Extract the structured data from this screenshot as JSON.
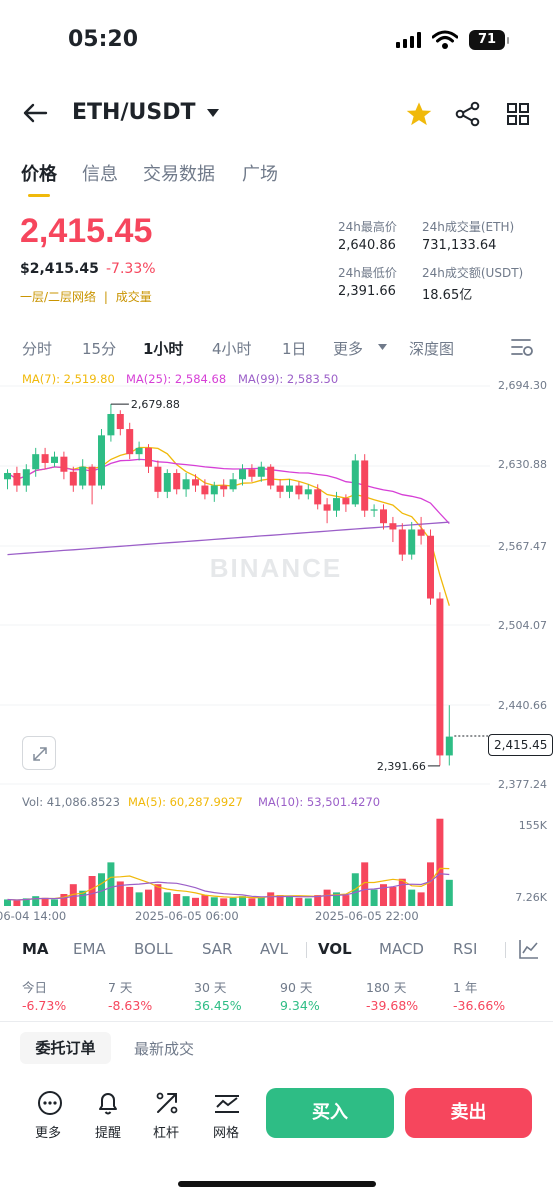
{
  "status_bar": {
    "time": "05:20",
    "battery": "71"
  },
  "header": {
    "pair": "ETH/USDT"
  },
  "tabs": [
    {
      "label": "价格",
      "active": true
    },
    {
      "label": "信息",
      "active": false
    },
    {
      "label": "交易数据",
      "active": false
    },
    {
      "label": "广场",
      "active": false
    }
  ],
  "price": {
    "last": "2,415.45",
    "usd": "$2,415.45",
    "change_pct": "-7.33%",
    "network_link": "一层/二层网络",
    "volume_link": "成交量",
    "high_label": "24h最高价",
    "high": "2,640.86",
    "low_label": "24h最低价",
    "low": "2,391.66",
    "vol_eth_label": "24h成交量(ETH)",
    "vol_eth": "731,133.64",
    "vol_usdt_label": "24h成交额(USDT)",
    "vol_usdt": "18.65亿"
  },
  "timeframes": [
    {
      "label": "分时",
      "active": false
    },
    {
      "label": "15分",
      "active": false
    },
    {
      "label": "1小时",
      "active": true
    },
    {
      "label": "4小时",
      "active": false
    },
    {
      "label": "1日",
      "active": false
    },
    {
      "label": "更多",
      "active": false
    },
    {
      "label": "深度图",
      "active": false
    }
  ],
  "ma_legend": {
    "ma7": "MA(7): 2,519.80",
    "ma25": "MA(25): 2,584.68",
    "ma99": "MA(99): 2,583.50"
  },
  "vol_legend": {
    "vol": "Vol: 41,086.8523",
    "ma5": "MA(5): 60,287.9927",
    "ma10": "MA(10): 53,501.4270"
  },
  "colors": {
    "up": "#2ebd85",
    "down": "#f6465d",
    "ma7": "#f0b90b",
    "ma25": "#d63fd6",
    "ma99": "#9b5fc8",
    "accent": "#f0b90b"
  },
  "watermark": "BINANCE",
  "chart_data": {
    "type": "candlestick",
    "price_axis": [
      "2,694.30",
      "2,630.88",
      "2,567.47",
      "2,504.07",
      "2,440.66",
      "2,377.24"
    ],
    "ylim": [
      2377.24,
      2694.3
    ],
    "volume_axis": [
      "155K",
      "7.26K"
    ],
    "time_axis": [
      "06-04 14:00",
      "2025-06-05 06:00",
      "2025-06-05 22:00"
    ],
    "high_marker": "2,679.88",
    "low_marker": "2,391.66",
    "last_price_tag": "2,415.45",
    "candles": [
      [
        2620,
        2625,
        2612,
        2628,
        12
      ],
      [
        2625,
        2615,
        2610,
        2630,
        10
      ],
      [
        2615,
        2628,
        2610,
        2632,
        14
      ],
      [
        2628,
        2640,
        2622,
        2645,
        18
      ],
      [
        2640,
        2633,
        2628,
        2645,
        15
      ],
      [
        2633,
        2638,
        2630,
        2642,
        12
      ],
      [
        2638,
        2626,
        2620,
        2642,
        22
      ],
      [
        2626,
        2615,
        2610,
        2630,
        40
      ],
      [
        2615,
        2630,
        2612,
        2636,
        28
      ],
      [
        2630,
        2615,
        2600,
        2632,
        55
      ],
      [
        2615,
        2655,
        2612,
        2660,
        60
      ],
      [
        2655,
        2672,
        2650,
        2680,
        80
      ],
      [
        2672,
        2660,
        2655,
        2675,
        45
      ],
      [
        2660,
        2640,
        2636,
        2665,
        35
      ],
      [
        2640,
        2645,
        2635,
        2650,
        25
      ],
      [
        2645,
        2630,
        2625,
        2648,
        30
      ],
      [
        2630,
        2610,
        2605,
        2635,
        40
      ],
      [
        2610,
        2625,
        2605,
        2628,
        25
      ],
      [
        2625,
        2612,
        2608,
        2628,
        22
      ],
      [
        2612,
        2620,
        2606,
        2625,
        18
      ],
      [
        2620,
        2615,
        2610,
        2624,
        15
      ],
      [
        2615,
        2608,
        2604,
        2620,
        20
      ],
      [
        2608,
        2615,
        2602,
        2618,
        16
      ],
      [
        2615,
        2612,
        2606,
        2620,
        14
      ],
      [
        2612,
        2620,
        2610,
        2625,
        15
      ],
      [
        2620,
        2628,
        2615,
        2632,
        18
      ],
      [
        2628,
        2622,
        2618,
        2632,
        14
      ],
      [
        2622,
        2630,
        2618,
        2634,
        16
      ],
      [
        2630,
        2615,
        2612,
        2632,
        25
      ],
      [
        2615,
        2610,
        2605,
        2620,
        20
      ],
      [
        2610,
        2615,
        2605,
        2620,
        18
      ],
      [
        2615,
        2608,
        2604,
        2618,
        15
      ],
      [
        2608,
        2612,
        2604,
        2616,
        14
      ],
      [
        2612,
        2600,
        2596,
        2616,
        20
      ],
      [
        2600,
        2595,
        2585,
        2605,
        30
      ],
      [
        2595,
        2605,
        2590,
        2610,
        25
      ],
      [
        2605,
        2600,
        2594,
        2608,
        20
      ],
      [
        2600,
        2635,
        2598,
        2640,
        60
      ],
      [
        2635,
        2595,
        2590,
        2640,
        80
      ],
      [
        2595,
        2596,
        2590,
        2600,
        30
      ],
      [
        2596,
        2585,
        2580,
        2600,
        40
      ],
      [
        2585,
        2580,
        2570,
        2590,
        35
      ],
      [
        2580,
        2560,
        2555,
        2585,
        50
      ],
      [
        2560,
        2580,
        2556,
        2586,
        30
      ],
      [
        2580,
        2575,
        2568,
        2590,
        25
      ],
      [
        2575,
        2525,
        2520,
        2580,
        80
      ],
      [
        2525,
        2400,
        2392,
        2530,
        160
      ],
      [
        2400,
        2415,
        2392,
        2440,
        48
      ]
    ]
  },
  "indicators": [
    {
      "label": "MA",
      "active": true
    },
    {
      "label": "EMA",
      "active": false
    },
    {
      "label": "BOLL",
      "active": false
    },
    {
      "label": "SAR",
      "active": false
    },
    {
      "label": "AVL",
      "active": false
    },
    {
      "label": "VOL",
      "active": true
    },
    {
      "label": "MACD",
      "active": false
    },
    {
      "label": "RSI",
      "active": false
    }
  ],
  "performance": [
    {
      "label": "今日",
      "value": "-6.73%",
      "dir": "down"
    },
    {
      "label": "7 天",
      "value": "-8.63%",
      "dir": "down"
    },
    {
      "label": "30 天",
      "value": "36.45%",
      "dir": "up"
    },
    {
      "label": "90 天",
      "value": "9.34%",
      "dir": "up"
    },
    {
      "label": "180 天",
      "value": "-39.68%",
      "dir": "down"
    },
    {
      "label": "1 年",
      "value": "-36.66%",
      "dir": "down"
    }
  ],
  "order_tabs": {
    "active": "委托订单",
    "other": "最新成交"
  },
  "bottom_nav": [
    {
      "label": "更多",
      "icon": "more-dots-icon"
    },
    {
      "label": "提醒",
      "icon": "bell-icon"
    },
    {
      "label": "杠杆",
      "icon": "leverage-icon"
    },
    {
      "label": "网格",
      "icon": "grid-trading-icon"
    }
  ],
  "buttons": {
    "buy": "买入",
    "sell": "卖出"
  }
}
